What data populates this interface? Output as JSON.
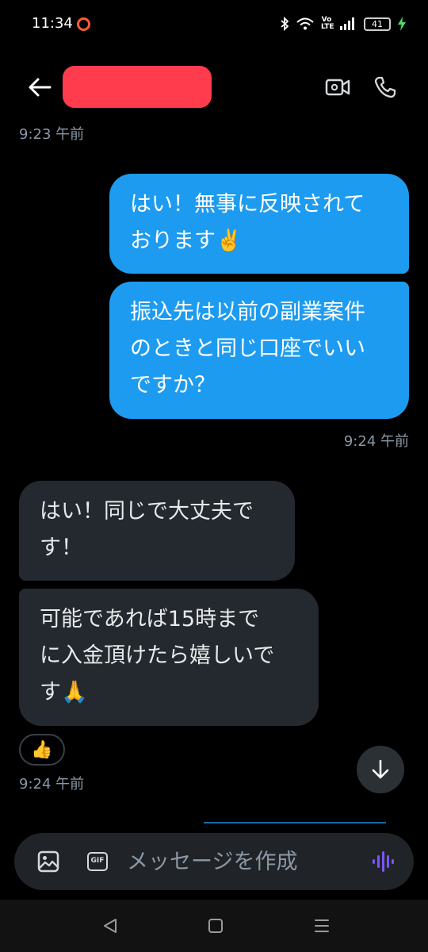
{
  "status_bar": {
    "time": "11:34",
    "battery": "41",
    "volte": "Vo LTE"
  },
  "header": {
    "contact_name": ""
  },
  "messages": [
    {
      "sender": "me",
      "lines": [
        "はい！無事に反映されて",
        "おります✌️"
      ]
    },
    {
      "sender": "me",
      "lines": [
        "振込先は以前の副業案件",
        "のときと同じ口座でいい",
        "ですか？"
      ]
    },
    {
      "sender": "them",
      "lines": [
        "はい！同じで大丈夫で",
        "す！"
      ]
    },
    {
      "sender": "them",
      "lines": [
        "可能であれば15時まで",
        "に入金頂けたら嬉しいで",
        "す🙏"
      ]
    }
  ],
  "texts": {
    "b1": "はい！無事に反映されて\nおります✌️",
    "b2": "振込先は以前の副業案件\nのときと同じ口座でいい\nですか？",
    "b3": "はい！同じで大丈夫で\nす！",
    "b4": "可能であれば15時まで\nに入金頂けたら嬉しいで\nす🙏"
  },
  "timestamps": {
    "first": "9:23 午前",
    "second": "9:24 午前",
    "third": "9:24 午前"
  },
  "reaction": "👍",
  "composer": {
    "placeholder": "メッセージを作成",
    "gif_label": "GIF"
  },
  "colors": {
    "sent_bubble": "#1d9bf0",
    "received_bubble": "#23292f",
    "redaction": "#ff3b4e",
    "voice_accent": "#7856ff",
    "background": "#000000"
  },
  "icons": {
    "back": "arrow-left-icon",
    "video": "video-camera-icon",
    "call": "phone-icon",
    "scroll": "arrow-down-icon",
    "image": "image-icon",
    "gif": "gif-icon",
    "voice": "voice-wave-icon"
  }
}
